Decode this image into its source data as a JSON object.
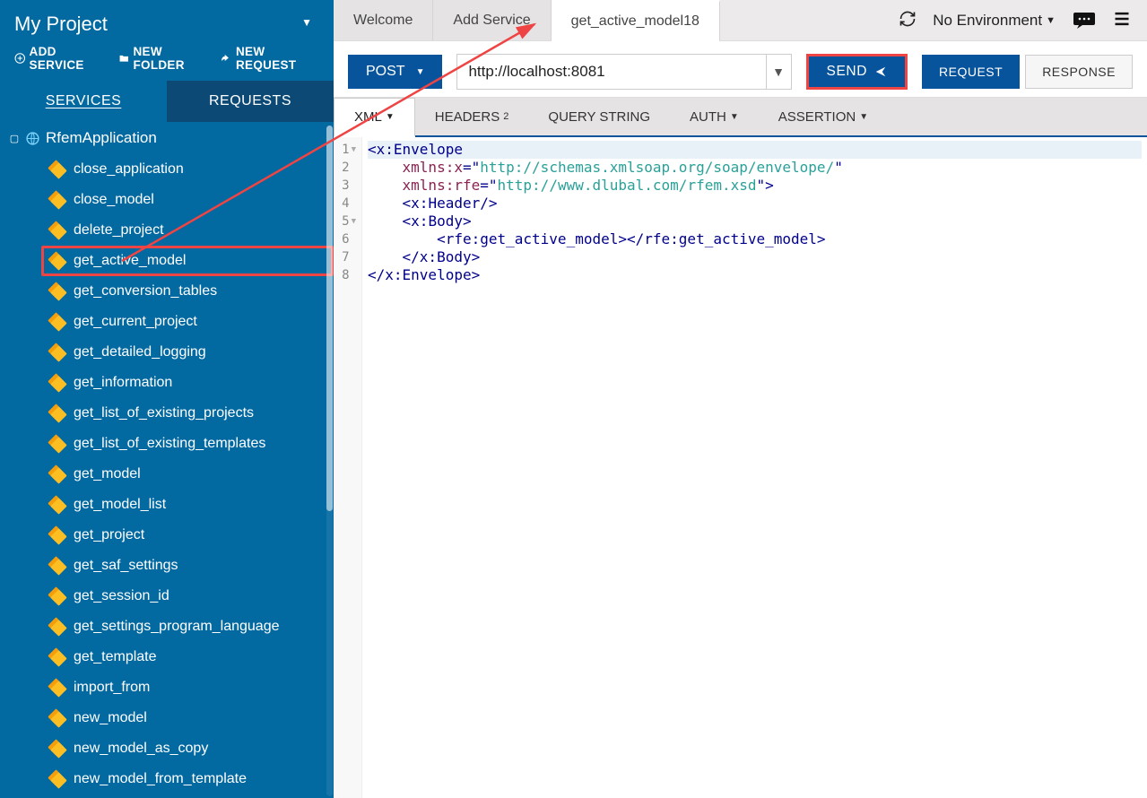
{
  "sidebar": {
    "project_title": "My Project",
    "actions": {
      "add_service": "ADD SERVICE",
      "new_folder": "NEW FOLDER",
      "new_request": "NEW REQUEST"
    },
    "tabs": {
      "services": "SERVICES",
      "requests": "REQUESTS"
    },
    "service_name": "RfemApplication",
    "operations": [
      "close_application",
      "close_model",
      "delete_project",
      "get_active_model",
      "get_conversion_tables",
      "get_current_project",
      "get_detailed_logging",
      "get_information",
      "get_list_of_existing_projects",
      "get_list_of_existing_templates",
      "get_model",
      "get_model_list",
      "get_project",
      "get_saf_settings",
      "get_session_id",
      "get_settings_program_language",
      "get_template",
      "import_from",
      "new_model",
      "new_model_as_copy",
      "new_model_from_template"
    ],
    "highlighted_index": 3
  },
  "top_tabs": [
    "Welcome",
    "Add Service",
    "get_active_model18"
  ],
  "active_tab_index": 2,
  "environment_label": "No Environment",
  "request": {
    "method": "POST",
    "url": "http://localhost:8081",
    "send_label": "SEND",
    "view_tabs": {
      "request": "REQUEST",
      "response": "RESPONSE"
    }
  },
  "sub_tabs": {
    "xml": "XML",
    "headers": "HEADERS",
    "headers_badge": "2",
    "query": "QUERY STRING",
    "auth": "AUTH",
    "assertion": "ASSERTION"
  },
  "code": {
    "lines": [
      {
        "num": 1,
        "fold": true,
        "indent": 0,
        "hl": true,
        "tokens": [
          {
            "c": "p",
            "t": "<"
          },
          {
            "c": "t",
            "t": "x:Envelope"
          }
        ]
      },
      {
        "num": 2,
        "indent": 2,
        "tokens": [
          {
            "c": "a",
            "t": "xmlns:x"
          },
          {
            "c": "p",
            "t": "="
          },
          {
            "c": "p",
            "t": "\""
          },
          {
            "c": "s",
            "t": "http://schemas.xmlsoap.org/soap/envelope/"
          },
          {
            "c": "p",
            "t": "\""
          }
        ]
      },
      {
        "num": 3,
        "indent": 2,
        "tokens": [
          {
            "c": "a",
            "t": "xmlns:rfe"
          },
          {
            "c": "p",
            "t": "="
          },
          {
            "c": "p",
            "t": "\""
          },
          {
            "c": "s",
            "t": "http://www.dlubal.com/rfem.xsd"
          },
          {
            "c": "p",
            "t": "\">"
          }
        ]
      },
      {
        "num": 4,
        "indent": 2,
        "tokens": [
          {
            "c": "p",
            "t": "<"
          },
          {
            "c": "t",
            "t": "x:Header"
          },
          {
            "c": "p",
            "t": "/>"
          }
        ]
      },
      {
        "num": 5,
        "fold": true,
        "indent": 2,
        "tokens": [
          {
            "c": "p",
            "t": "<"
          },
          {
            "c": "t",
            "t": "x:Body"
          },
          {
            "c": "p",
            "t": ">"
          }
        ]
      },
      {
        "num": 6,
        "indent": 4,
        "tokens": [
          {
            "c": "p",
            "t": "<"
          },
          {
            "c": "t",
            "t": "rfe:get_active_model"
          },
          {
            "c": "p",
            "t": "></"
          },
          {
            "c": "t",
            "t": "rfe:get_active_model"
          },
          {
            "c": "p",
            "t": ">"
          }
        ]
      },
      {
        "num": 7,
        "indent": 2,
        "tokens": [
          {
            "c": "p",
            "t": "</"
          },
          {
            "c": "t",
            "t": "x:Body"
          },
          {
            "c": "p",
            "t": ">"
          }
        ]
      },
      {
        "num": 8,
        "indent": 0,
        "tokens": [
          {
            "c": "p",
            "t": "</"
          },
          {
            "c": "t",
            "t": "x:Envelope"
          },
          {
            "c": "p",
            "t": ">"
          }
        ]
      }
    ]
  }
}
